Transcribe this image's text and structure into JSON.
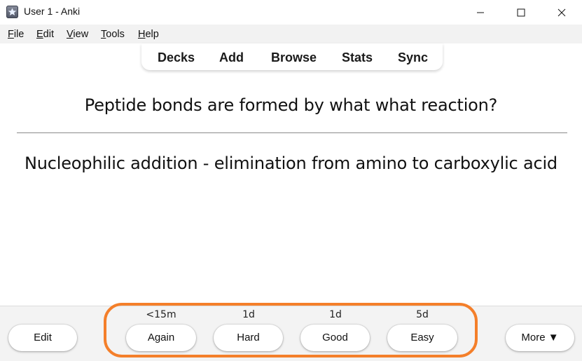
{
  "window": {
    "title": "User 1 - Anki",
    "icon": "anki-app-icon"
  },
  "menu": [
    "File",
    "Edit",
    "View",
    "Tools",
    "Help"
  ],
  "toolbar": {
    "tabs": [
      "Decks",
      "Add",
      "Browse",
      "Stats",
      "Sync"
    ]
  },
  "card": {
    "question": "Peptide bonds are formed by what what reaction?",
    "answer": "Nucleophilic addition - elimination from amino to carboxylic acid"
  },
  "review": {
    "edit_label": "Edit",
    "more_label": "More ▼",
    "answers": [
      {
        "label": "Again",
        "interval": "<15m"
      },
      {
        "label": "Hard",
        "interval": "1d"
      },
      {
        "label": "Good",
        "interval": "1d"
      },
      {
        "label": "Easy",
        "interval": "5d"
      }
    ]
  },
  "colors": {
    "highlight": "#f47f2a",
    "bottom_bar": "#f3f3f3",
    "menu_bar": "#f2f2f2"
  }
}
